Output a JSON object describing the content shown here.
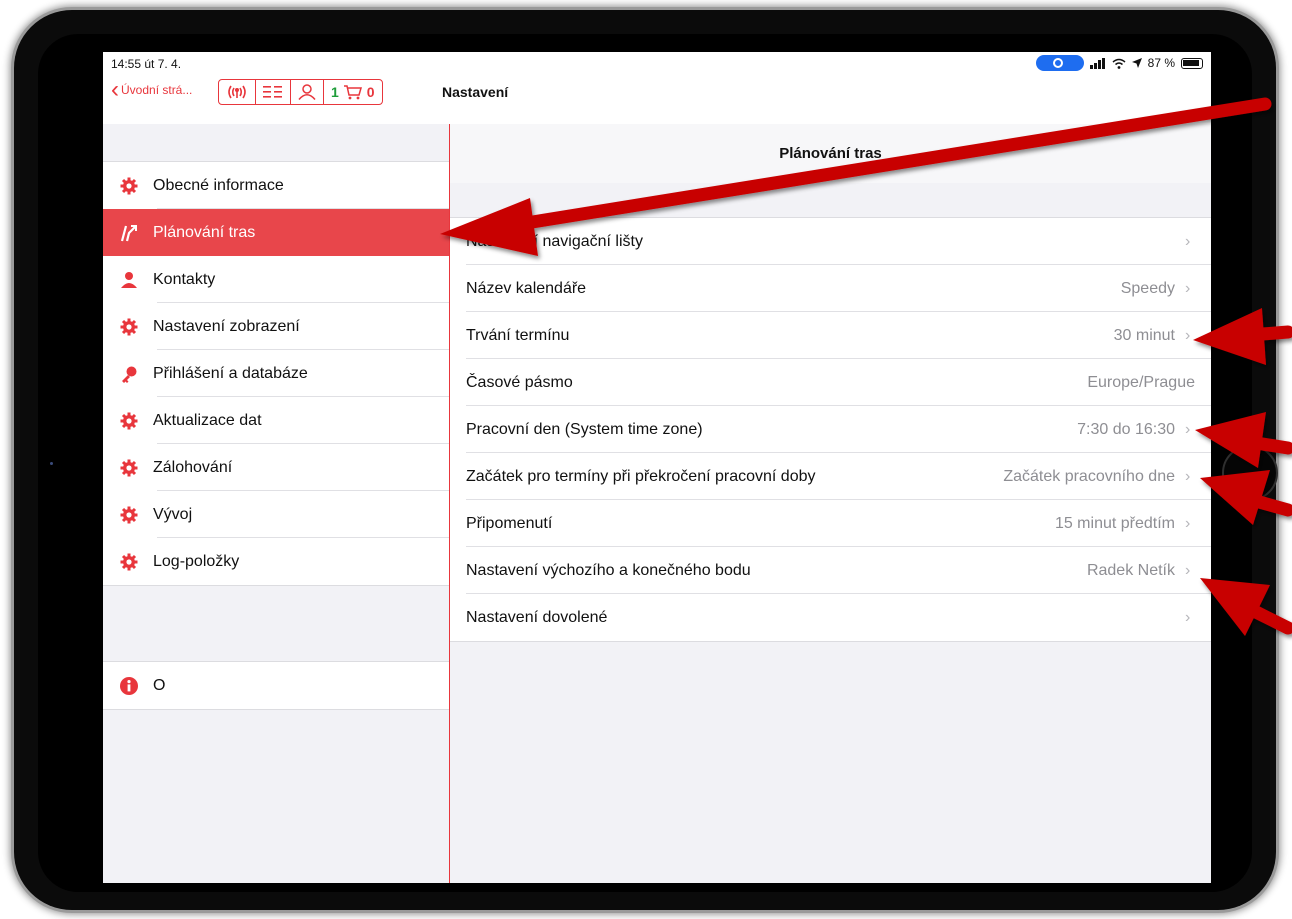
{
  "status": {
    "time": "14:55  út 7. 4.",
    "battery": "87 %"
  },
  "nav": {
    "back_label": "Úvodní strá...",
    "title": "Nastavení",
    "toolbar": {
      "cart_count": "1",
      "cart_value": "0"
    }
  },
  "sidebar": {
    "items": [
      {
        "label": "Obecné informace",
        "icon": "gear-icon"
      },
      {
        "label": "Plánování tras",
        "icon": "route-icon",
        "active": true
      },
      {
        "label": "Kontakty",
        "icon": "person-icon"
      },
      {
        "label": "Nastavení zobrazení",
        "icon": "gear-icon"
      },
      {
        "label": "Přihlášení a databáze",
        "icon": "key-icon"
      },
      {
        "label": "Aktualizace dat",
        "icon": "gear-icon"
      },
      {
        "label": "Zálohování",
        "icon": "gear-icon"
      },
      {
        "label": "Vývoj",
        "icon": "gear-icon"
      },
      {
        "label": "Log-položky",
        "icon": "gear-icon"
      }
    ],
    "about": {
      "label": "O",
      "icon": "info-icon"
    }
  },
  "detail": {
    "title": "Plánování tras",
    "rows": [
      {
        "label": "Nastavení navigační lišty",
        "value": ""
      },
      {
        "label": "Název kalendáře",
        "value": "Speedy"
      },
      {
        "label": "Trvání termínu",
        "value": "30 minut"
      },
      {
        "label": "Časové pásmo",
        "value": "Europe/Prague"
      },
      {
        "label": "Pracovní den (System time zone)",
        "value": "7:30 do 16:30"
      },
      {
        "label": "Začátek pro termíny při překročení pracovní doby",
        "value": "Začátek pracovního dne"
      },
      {
        "label": "Připomenutí",
        "value": "15 minut předtím"
      },
      {
        "label": "Nastavení výchozího a konečného bodu",
        "value": "Radek Netík"
      },
      {
        "label": "Nastavení dovolené",
        "value": ""
      }
    ]
  },
  "colors": {
    "accent": "#e8363c",
    "active_row": "#e8464b",
    "annotation": "#c80000"
  }
}
